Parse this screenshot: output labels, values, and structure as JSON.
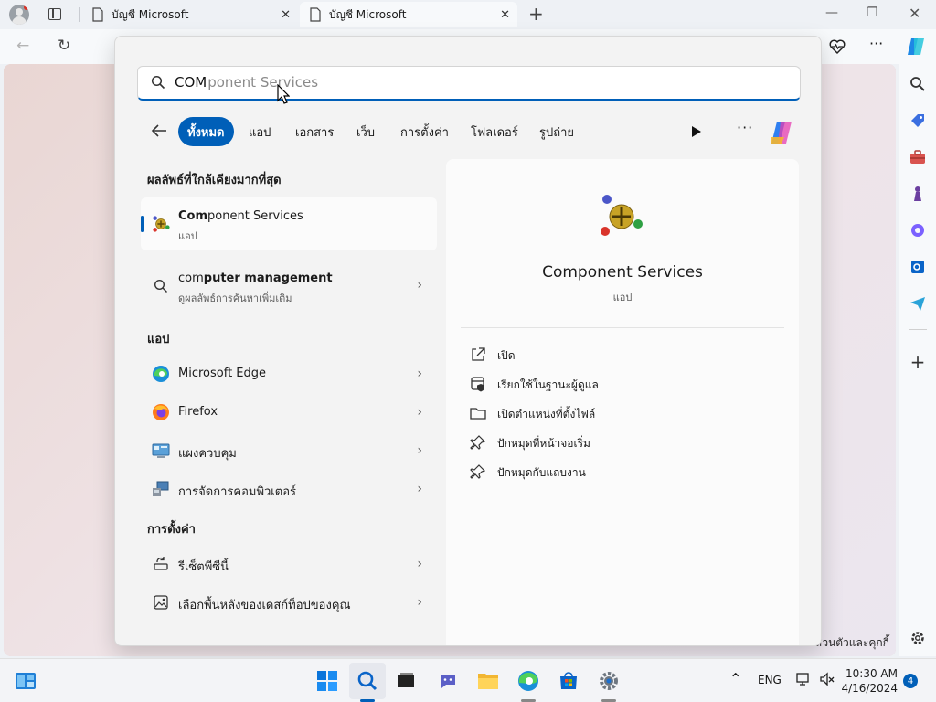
{
  "browser": {
    "tabs": [
      {
        "title": "บัญชี Microsoft",
        "active": false
      },
      {
        "title": "บัญชี Microsoft",
        "active": true
      }
    ],
    "new_tab_label": "+",
    "footer_text": "ส่วนตัวและคุกกี้"
  },
  "search": {
    "query_typed": "COM",
    "query_completion": "ponent Services",
    "filters": [
      "ทั้งหมด",
      "แอป",
      "เอกสาร",
      "เว็บ",
      "การตั้งค่า",
      "โฟลเดอร์",
      "รูปถ่าย"
    ],
    "active_filter": "ทั้งหมด"
  },
  "results": {
    "best_match_heading": "ผลลัพธ์ที่ใกล้เคียงมากที่สุด",
    "best_match": {
      "bold": "Com",
      "rest": "ponent Services",
      "subtitle": "แอป"
    },
    "web_suggestion": {
      "bold": "com",
      "rest": "puter management",
      "subtitle": "ดูผลลัพธ์การค้นหาเพิ่มเติม"
    },
    "apps_heading": "แอป",
    "apps": [
      {
        "label": "Microsoft Edge",
        "icon": "edge-icon"
      },
      {
        "label": "Firefox",
        "icon": "firefox-icon"
      },
      {
        "label": "แผงควบคุม",
        "icon": "control-panel-icon"
      },
      {
        "label": "การจัดการคอมพิวเตอร์",
        "icon": "computer-management-icon"
      }
    ],
    "settings_heading": "การตั้งค่า",
    "settings": [
      {
        "label": "รีเซ็ตพีซีนี้",
        "icon": "reset-pc-icon"
      },
      {
        "label": "เลือกพื้นหลังของเดสก์ท็อปของคุณ",
        "icon": "wallpaper-icon"
      }
    ]
  },
  "details": {
    "app_name": "Component Services",
    "app_type": "แอป",
    "actions": [
      {
        "label": "เปิด",
        "icon": "open-icon"
      },
      {
        "label": "เรียกใช้ในฐานะผู้ดูแล",
        "icon": "run-as-admin-icon"
      },
      {
        "label": "เปิดตำแหน่งที่ตั้งไฟล์",
        "icon": "folder-icon"
      },
      {
        "label": "ปักหมุดที่หน้าจอเริ่ม",
        "icon": "pin-icon"
      },
      {
        "label": "ปักหมุดกับแถบงาน",
        "icon": "pin-icon"
      }
    ]
  },
  "taskbar": {
    "language": "ENG",
    "time": "10:30 AM",
    "date": "4/16/2024",
    "notification_count": "4"
  },
  "colors": {
    "accent": "#005fb8",
    "flyout_bg": "#f3f3f3"
  }
}
